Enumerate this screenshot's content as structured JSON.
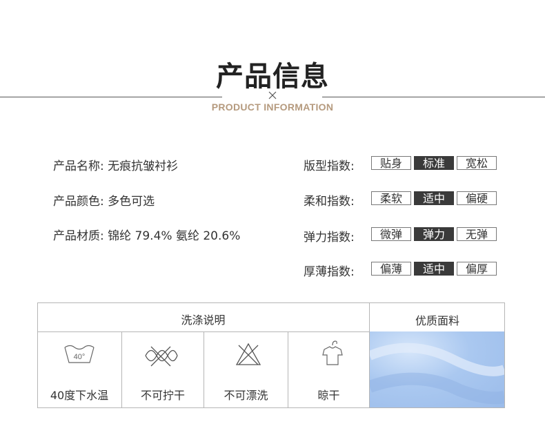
{
  "header": {
    "title": "产品信息",
    "subtitle": "PRODUCT INFORMATION"
  },
  "info": {
    "name_label": "产品名称:",
    "name_value": "无痕抗皱衬衫",
    "color_label": "产品颜色:",
    "color_value": "多色可选",
    "material_label": "产品材质:",
    "material_value": "锦纶 79.4% 氨纶 20.6%"
  },
  "indices": [
    {
      "label": "版型指数:",
      "options": [
        "贴身",
        "标准",
        "宽松"
      ],
      "selected": 1
    },
    {
      "label": "柔和指数:",
      "options": [
        "柔软",
        "适中",
        "偏硬"
      ],
      "selected": 1
    },
    {
      "label": "弹力指数:",
      "options": [
        "微弹",
        "弹力",
        "无弹"
      ],
      "selected": 1
    },
    {
      "label": "厚薄指数:",
      "options": [
        "偏薄",
        "适中",
        "偏厚"
      ],
      "selected": 1
    }
  ],
  "care": {
    "header": "洗涤说明",
    "items": [
      {
        "label": "40度下水温",
        "icon": "wash-40-icon",
        "icon_text": "40°"
      },
      {
        "label": "不可拧干",
        "icon": "no-wring-icon"
      },
      {
        "label": "不可漂洗",
        "icon": "no-bleach-icon"
      },
      {
        "label": "晾干",
        "icon": "hang-dry-icon"
      }
    ]
  },
  "fabric": {
    "header": "优质面料"
  },
  "colors": {
    "accent": "#b59a7e",
    "selected_bg": "#3a3a3a",
    "fabric_blue": "#aac8f0"
  }
}
